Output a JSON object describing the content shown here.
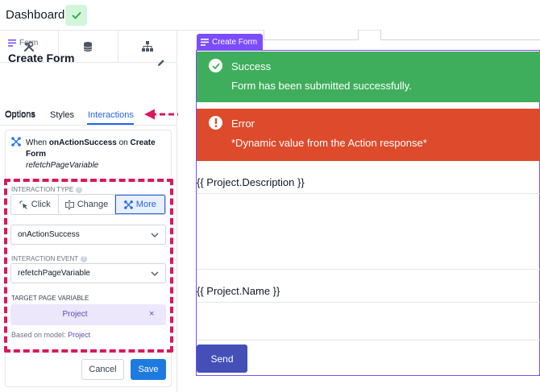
{
  "topbar": {
    "title": "Dashboard",
    "confirm_icon": "check-icon"
  },
  "left_panel": {
    "tool_tabs": [
      {
        "icon": "tools-icon"
      },
      {
        "icon": "database-icon"
      },
      {
        "icon": "sitemap-icon"
      }
    ],
    "component_type": "Form",
    "component_title": "Create Form",
    "tabs": {
      "options": "Options",
      "styles": "Styles",
      "interactions": "Interactions"
    },
    "summary": {
      "prefix": "When",
      "event": "onActionSuccess",
      "on": "on",
      "target": "Create Form",
      "action": "refetchPageVariable"
    },
    "interaction_type": {
      "label": "INTERACTION TYPE",
      "options": {
        "click": "Click",
        "change": "Change",
        "more": "More"
      },
      "selected": "More"
    },
    "trigger_select": "onActionSuccess",
    "interaction_event": {
      "label": "INTERACTION EVENT",
      "value": "refetchPageVariable"
    },
    "target_page_variable": {
      "label": "TARGET PAGE VARIABLE",
      "value": "Project",
      "remove": "×"
    },
    "model": {
      "prefix": "Based on model:",
      "name": "Project"
    },
    "buttons": {
      "cancel": "Cancel",
      "save": "Save"
    }
  },
  "canvas": {
    "component_tag": "Create Form",
    "success": {
      "title": "Success",
      "message": "Form has been submitted successfully."
    },
    "error": {
      "title": "Error",
      "message": "*Dynamic value from the Action response*"
    },
    "fields": [
      {
        "label": "{{ Project.Description }}"
      },
      {
        "label": "{{ Project.Name }}"
      }
    ],
    "submit": "Send"
  },
  "colors": {
    "accent": "#2563eb",
    "highlight_dashed": "#d9195a",
    "success": "#3fae5c",
    "error": "#dd4b2c",
    "component": "#7c4dff",
    "send": "#4450b8"
  }
}
